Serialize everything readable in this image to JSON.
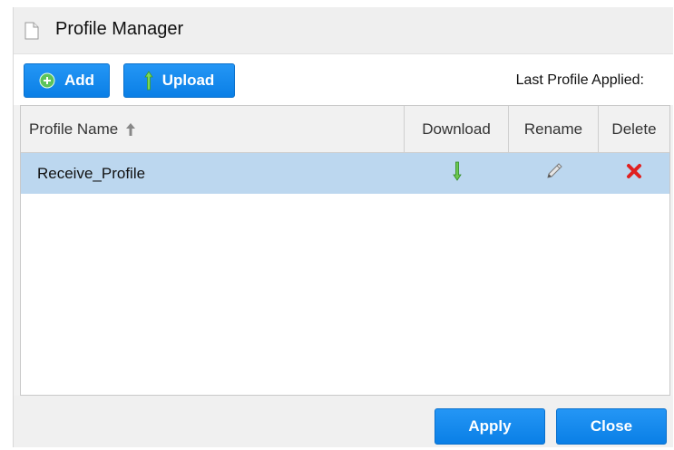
{
  "dialog": {
    "title": "Profile Manager",
    "title_icon": "document-icon"
  },
  "toolbar": {
    "add_label": "Add",
    "add_icon": "plus-circle-icon",
    "upload_label": "Upload",
    "upload_icon": "upload-arrow-icon",
    "last_profile_label": "Last Profile Applied:"
  },
  "table": {
    "columns": [
      "Profile Name",
      "Download",
      "Rename",
      "Delete"
    ],
    "sort_icon": "sort-up-arrow-icon",
    "rows": [
      {
        "name": "Receive_Profile",
        "download_icon": "download-arrow-icon",
        "rename_icon": "pencil-icon",
        "delete_icon": "red-x-icon",
        "selected": true
      }
    ]
  },
  "footer": {
    "apply_label": "Apply",
    "close_label": "Close"
  },
  "colors": {
    "button_blue": "#0a7fe6",
    "selected_row": "#bcd7ef",
    "download_green": "#3a9a2a",
    "delete_red": "#e02020"
  }
}
